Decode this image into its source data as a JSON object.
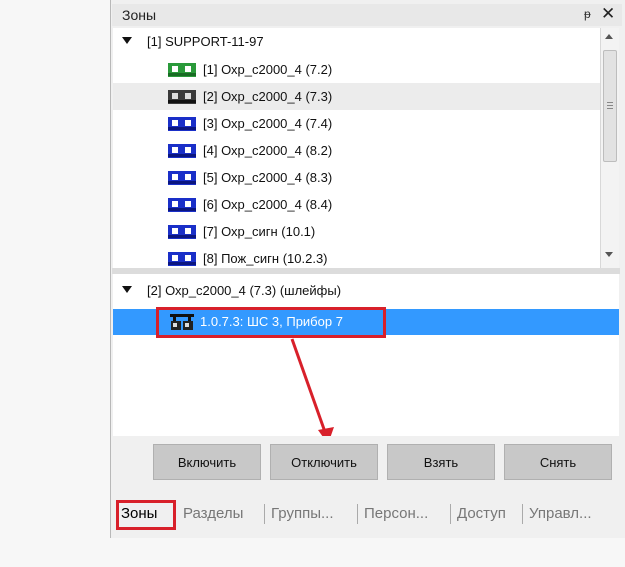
{
  "panel": {
    "title": "Зоны",
    "pin_glyph": "ᵽ",
    "close_glyph": "✕"
  },
  "tree_top": {
    "root_label": "[1] SUPPORT-11-97",
    "items": [
      {
        "label": "[1] Охр_с2000_4 (7.2)",
        "icon": "zone-green-icon",
        "color": "#2a9a3a"
      },
      {
        "label": "[2] Охр_с2000_4 (7.3)",
        "icon": "zone-dark-icon",
        "color": "#3a3a3a"
      },
      {
        "label": "[3] Охр_с2000_4 (7.4)",
        "icon": "zone-blue-icon",
        "color": "#1a2fc8"
      },
      {
        "label": "[4] Охр_с2000_4 (8.2)",
        "icon": "zone-blue-icon",
        "color": "#1a2fc8"
      },
      {
        "label": "[5] Охр_с2000_4 (8.3)",
        "icon": "zone-blue-icon",
        "color": "#1a2fc8"
      },
      {
        "label": "[6] Охр_с2000_4 (8.4)",
        "icon": "zone-blue-icon",
        "color": "#1a2fc8"
      },
      {
        "label": "[7] Охр_сигн (10.1)",
        "icon": "zone-blue-icon",
        "color": "#1a2fc8"
      },
      {
        "label": "[8] Пож_сигн (10.2.3)",
        "icon": "zone-blue-icon",
        "color": "#1a2fc8"
      }
    ]
  },
  "tree_bottom": {
    "root_label": "[2] Охр_с2000_4 (7.3) (шлейфы)",
    "selected_label": "1.0.7.3: ШС 3, Прибор 7"
  },
  "buttons": {
    "enable": "Включить",
    "disable": "Отключить",
    "arm": "Взять",
    "disarm": "Снять"
  },
  "tabs": [
    "Зоны",
    "Разделы",
    "Группы...",
    "Персон...",
    "Доступ",
    "Управл..."
  ],
  "colors": {
    "selection": "#3399ff",
    "highlight": "#d8202a"
  }
}
